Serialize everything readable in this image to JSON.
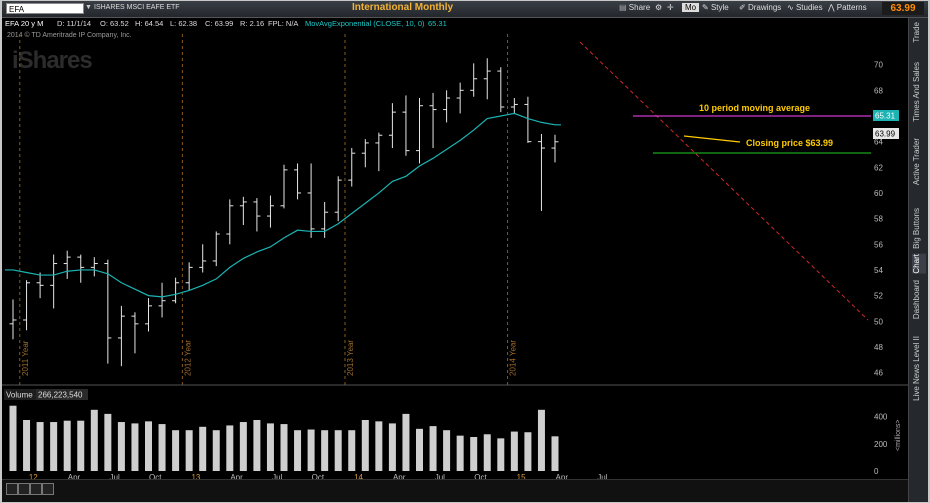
{
  "header": {
    "symbol": "EFA",
    "symbol_name": "ISHARES MSCI EAFE ETF",
    "title": "International Monthly",
    "share_label": "Share",
    "mode_label": "Mo",
    "style_label": "Style",
    "drawings_label": "Drawings",
    "studies_label": "Studies",
    "patterns_label": "Patterns",
    "last_price": "63.99"
  },
  "info": {
    "period": "EFA 20 y M",
    "date": "D: 11/1/14",
    "open": "O: 63.52",
    "high": "H: 64.54",
    "low": "L: 62.38",
    "close": "C: 63.99",
    "range": "R: 2.16",
    "fpl": "FPL: N/A",
    "study": "MovAvgExponential (CLOSE, 10, 0)",
    "study_value": "65.31"
  },
  "copyright": "2014 © TD Ameritrade IP Company, Inc.",
  "watermark": "iShares",
  "sidebar": {
    "tabs": [
      "Trade",
      "Times And Sales",
      "Active Trader",
      "Big Buttons",
      "Chart",
      "Dashboard",
      "Level II",
      "Live News"
    ],
    "active": "Chart"
  },
  "chart_data": {
    "type": "ohlc-bar",
    "period": "monthly",
    "ylim": [
      45.5,
      72
    ],
    "y_ticks": [
      46,
      48,
      50,
      52,
      54,
      56,
      58,
      60,
      62,
      64,
      66,
      68,
      70
    ],
    "x_tick_labels": [
      {
        "label": "12",
        "idx": 1.5
      },
      {
        "label": "Apr",
        "idx": 4.5
      },
      {
        "label": "Jul",
        "idx": 7.5
      },
      {
        "label": "Oct",
        "idx": 10.5
      },
      {
        "label": "13",
        "idx": 13.5
      },
      {
        "label": "Apr",
        "idx": 16.5
      },
      {
        "label": "Jul",
        "idx": 19.5
      },
      {
        "label": "Oct",
        "idx": 22.5
      },
      {
        "label": "14",
        "idx": 25.5
      },
      {
        "label": "Apr",
        "idx": 28.5
      },
      {
        "label": "Jul",
        "idx": 31.5
      },
      {
        "label": "Oct",
        "idx": 34.5
      },
      {
        "label": "15",
        "idx": 37.5
      },
      {
        "label": "Apr",
        "idx": 40.5
      },
      {
        "label": "Jul",
        "idx": 43.5
      }
    ],
    "year_markers": [
      {
        "label": "2011 Year",
        "idx": 0.5
      },
      {
        "label": "2012 Year",
        "idx": 12.5
      },
      {
        "label": "2013 Year",
        "idx": 24.5
      },
      {
        "label": "2014 Year",
        "idx": 36.5
      }
    ],
    "bars": [
      {
        "o": 49.8,
        "h": 51.7,
        "l": 48.6,
        "c": 50.1
      },
      {
        "o": 50.1,
        "h": 53.2,
        "l": 49.3,
        "c": 53.0
      },
      {
        "o": 53.0,
        "h": 53.8,
        "l": 51.8,
        "c": 52.8
      },
      {
        "o": 52.8,
        "h": 55.2,
        "l": 51.0,
        "c": 54.5
      },
      {
        "o": 54.5,
        "h": 55.5,
        "l": 53.3,
        "c": 55.0
      },
      {
        "o": 55.0,
        "h": 55.2,
        "l": 53.0,
        "c": 54.2
      },
      {
        "o": 54.2,
        "h": 55.0,
        "l": 53.5,
        "c": 54.5
      },
      {
        "o": 54.5,
        "h": 54.8,
        "l": 46.7,
        "c": 48.7
      },
      {
        "o": 48.7,
        "h": 51.2,
        "l": 46.5,
        "c": 50.4
      },
      {
        "o": 50.4,
        "h": 50.7,
        "l": 47.5,
        "c": 49.8
      },
      {
        "o": 49.8,
        "h": 51.8,
        "l": 49.2,
        "c": 51.2
      },
      {
        "o": 51.2,
        "h": 53.0,
        "l": 50.3,
        "c": 51.6
      },
      {
        "o": 51.6,
        "h": 53.4,
        "l": 51.4,
        "c": 53.0
      },
      {
        "o": 53.0,
        "h": 54.6,
        "l": 52.4,
        "c": 54.2
      },
      {
        "o": 54.2,
        "h": 56.0,
        "l": 53.8,
        "c": 54.7
      },
      {
        "o": 54.7,
        "h": 57.0,
        "l": 54.3,
        "c": 56.8
      },
      {
        "o": 56.8,
        "h": 59.5,
        "l": 56.0,
        "c": 59.0
      },
      {
        "o": 59.0,
        "h": 59.7,
        "l": 57.5,
        "c": 59.3
      },
      {
        "o": 59.3,
        "h": 59.6,
        "l": 57.0,
        "c": 58.2
      },
      {
        "o": 58.2,
        "h": 59.8,
        "l": 57.3,
        "c": 59.0
      },
      {
        "o": 59.0,
        "h": 62.2,
        "l": 58.8,
        "c": 61.8
      },
      {
        "o": 61.8,
        "h": 62.3,
        "l": 59.5,
        "c": 60.0
      },
      {
        "o": 60.0,
        "h": 62.3,
        "l": 56.5,
        "c": 57.2
      },
      {
        "o": 57.2,
        "h": 59.3,
        "l": 56.5,
        "c": 58.5
      },
      {
        "o": 58.5,
        "h": 61.3,
        "l": 57.8,
        "c": 61.0
      },
      {
        "o": 61.0,
        "h": 63.5,
        "l": 60.5,
        "c": 63.1
      },
      {
        "o": 63.1,
        "h": 64.2,
        "l": 62.0,
        "c": 63.9
      },
      {
        "o": 63.9,
        "h": 64.7,
        "l": 61.7,
        "c": 64.5
      },
      {
        "o": 64.5,
        "h": 67.0,
        "l": 63.5,
        "c": 66.3
      },
      {
        "o": 66.3,
        "h": 67.6,
        "l": 62.9,
        "c": 63.3
      },
      {
        "o": 63.3,
        "h": 67.4,
        "l": 62.3,
        "c": 66.8
      },
      {
        "o": 66.8,
        "h": 67.8,
        "l": 63.5,
        "c": 66.5
      },
      {
        "o": 66.5,
        "h": 68.0,
        "l": 65.5,
        "c": 67.4
      },
      {
        "o": 67.4,
        "h": 68.6,
        "l": 66.2,
        "c": 68.0
      },
      {
        "o": 68.0,
        "h": 70.1,
        "l": 67.5,
        "c": 68.9
      },
      {
        "o": 68.9,
        "h": 70.5,
        "l": 67.3,
        "c": 69.5
      },
      {
        "o": 69.5,
        "h": 69.8,
        "l": 66.3,
        "c": 66.7
      },
      {
        "o": 66.7,
        "h": 67.4,
        "l": 66.2,
        "c": 66.9
      },
      {
        "o": 66.9,
        "h": 67.5,
        "l": 63.9,
        "c": 64.0
      },
      {
        "o": 64.0,
        "h": 64.6,
        "l": 58.6,
        "c": 63.5
      },
      {
        "o": 63.5,
        "h": 64.54,
        "l": 62.38,
        "c": 63.99
      }
    ],
    "ema": [
      54.0,
      53.8,
      53.6,
      53.6,
      53.9,
      54.0,
      54.0,
      53.7,
      53.0,
      52.5,
      52.0,
      51.9,
      52.1,
      52.4,
      52.8,
      53.3,
      54.2,
      54.9,
      55.4,
      55.8,
      56.5,
      57.1,
      57.0,
      57.0,
      57.6,
      58.4,
      59.2,
      60.0,
      60.9,
      61.3,
      62.1,
      62.7,
      63.4,
      64.1,
      64.9,
      65.8,
      66.0,
      66.2,
      65.8,
      65.5,
      65.31
    ],
    "ema_label": "65.31",
    "close_label": "63.99",
    "annotations": {
      "ema_text": "10 period moving average",
      "close_text": "Closing price $63.99"
    },
    "volume": {
      "label": "Volume",
      "last": "266,223,540",
      "units": "<millions>",
      "ylim": [
        0,
        500
      ],
      "y_ticks": [
        0,
        200,
        400
      ],
      "values": [
        480,
        375,
        360,
        360,
        370,
        370,
        450,
        420,
        360,
        350,
        365,
        345,
        300,
        300,
        325,
        300,
        335,
        360,
        375,
        350,
        345,
        300,
        305,
        300,
        300,
        300,
        375,
        365,
        350,
        420,
        310,
        330,
        300,
        260,
        250,
        270,
        240,
        290,
        285,
        450,
        255
      ]
    }
  }
}
